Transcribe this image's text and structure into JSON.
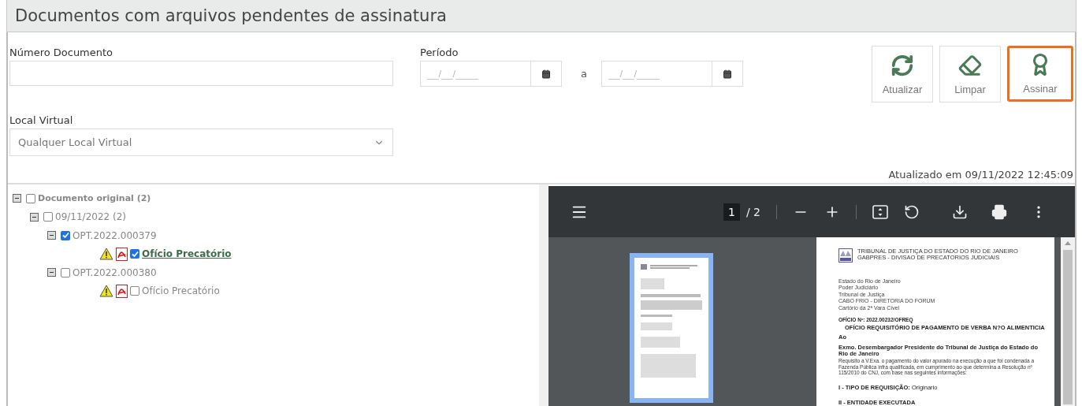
{
  "title": "Documentos com arquivos pendentes de assinatura",
  "filters": {
    "document_number": {
      "label": "Número Documento"
    },
    "period": {
      "label": "Período",
      "from": {
        "placeholder": "__/__/____"
      },
      "separator": "a",
      "to": {
        "placeholder": "__/__/____"
      }
    },
    "local_virtual": {
      "label": "Local Virtual",
      "value": "Qualquer Local Virtual"
    }
  },
  "actions": [
    {
      "label": "Atualizar",
      "kind": "refresh",
      "highlighted": false
    },
    {
      "label": "Limpar",
      "kind": "eraser",
      "highlighted": false
    },
    {
      "label": "Assinar",
      "kind": "seal",
      "highlighted": true
    }
  ],
  "updated": "Atualizado em 09/11/2022 12:45:09",
  "tree": [
    {
      "label": "Documento original (2)",
      "checked": false,
      "expanded": true,
      "children": [
        {
          "label": "09/11/2022 (2)",
          "checked": false,
          "expanded": true,
          "children": [
            {
              "label": "OPT.2022.000379",
              "checked": true,
              "expanded": true,
              "children": [
                {
                  "kind": "file",
                  "label": "Ofício Precatório",
                  "checked": true
                }
              ]
            },
            {
              "label": "OPT.2022.000380",
              "checked": false,
              "expanded": true,
              "children": [
                {
                  "kind": "file",
                  "label": "Ofício Precatório",
                  "checked": false
                }
              ]
            }
          ]
        }
      ]
    }
  ],
  "pdf_viewer": {
    "page": "1",
    "total": "/ 2",
    "document": {
      "header": [
        "TRIBUNAL DE JUSTIÇA DO ESTADO DO RIO DE JANEIRO",
        "GABPRES - DIVISAO DE PRECATORIOS JUDICIAIS"
      ],
      "blocks": [
        {
          "kind": "address",
          "lines": [
            "Estado do Rio de Janeiro",
            "Poder Judiciário",
            "Tribunal de Justiça",
            "CABO FRIO - DIRETORIA DO FORUM",
            "Cartório da 2ª Vara Cível"
          ]
        },
        {
          "kind": "bold",
          "text": "OFÍCIO Nº: 2022.00232/OFREQ"
        },
        {
          "kind": "title",
          "text": "OFÍCIO REQUISITÓRIO DE PAGAMENTO DE VERBA  N?O ALIMENTICIA"
        },
        {
          "kind": "heading",
          "text": "Ao"
        },
        {
          "kind": "heading",
          "text": "Exmo. Desembargador Presidente do Tribunal de Justiça do Estado do Rio de Janeiro"
        },
        {
          "kind": "text",
          "text": "Requisito a V.Exa. o pagamento do valor apurado na execução a que foi condenada a Fazenda Pública infra qualificada, em cumprimento ao que determina a Resolução nº 115/2010 do CNJ, com base nas seguintes informações:"
        },
        {
          "kind": "section",
          "text": "**I - TIPO DE REQUISIÇÃO:** Originario"
        },
        {
          "kind": "section",
          "text": "**II - ENTIDADE EXECUTADA**"
        }
      ]
    }
  }
}
